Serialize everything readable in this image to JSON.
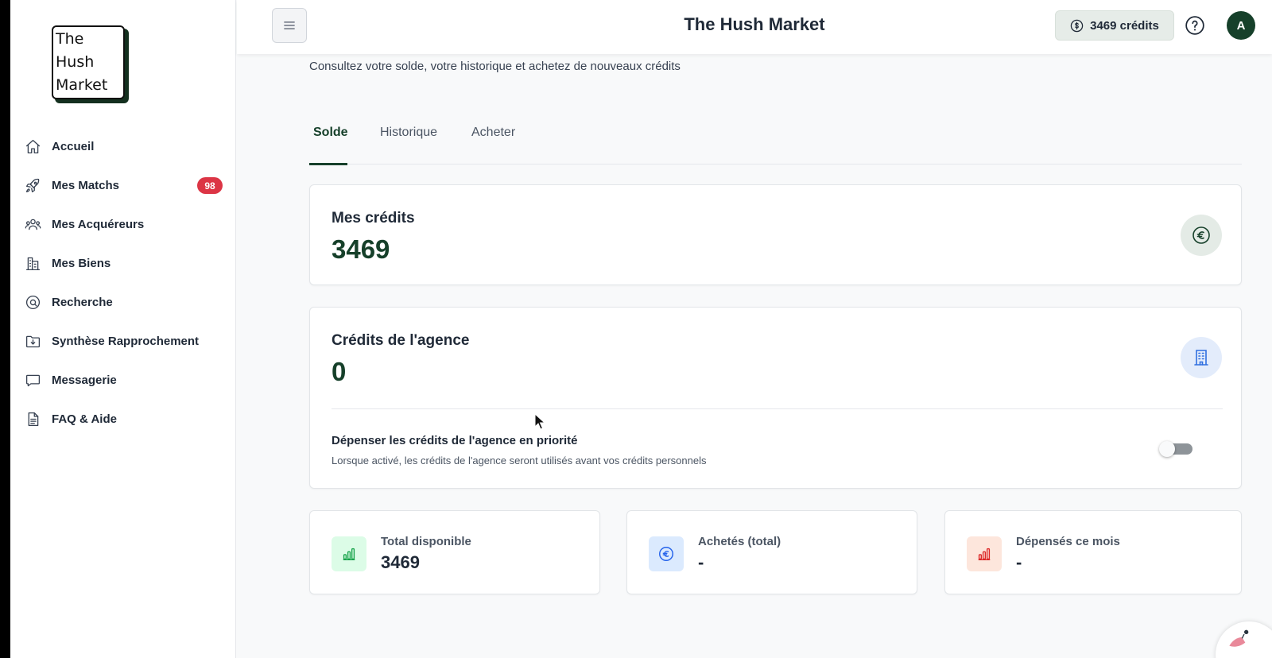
{
  "app": {
    "title": "The Hush Market"
  },
  "logo": {
    "lines": [
      "The",
      "Hush",
      "Market"
    ]
  },
  "sidebar": {
    "items": [
      {
        "label": "Accueil",
        "icon": "home-icon"
      },
      {
        "label": "Mes Matchs",
        "icon": "rocket-icon",
        "badge": "98"
      },
      {
        "label": "Mes Acquéreurs",
        "icon": "users-icon"
      },
      {
        "label": "Mes Biens",
        "icon": "buildings-icon"
      },
      {
        "label": "Recherche",
        "icon": "at-search-icon"
      },
      {
        "label": "Synthèse Rapprochement",
        "icon": "folder-download-icon"
      },
      {
        "label": "Messagerie",
        "icon": "chat-bubble-icon"
      },
      {
        "label": "FAQ & Aide",
        "icon": "document-icon"
      }
    ]
  },
  "header": {
    "credits_label": "3469 crédits",
    "avatar_initial": "A",
    "menu_icon": "hamburger-icon",
    "help_icon": "help-circle-icon"
  },
  "main": {
    "subtitle": "Consultez votre solde, votre historique et achetez de nouveaux crédits",
    "tabs": [
      {
        "label": "Solde",
        "active": true
      },
      {
        "label": "Historique",
        "active": false
      },
      {
        "label": "Acheter",
        "active": false
      }
    ],
    "my_credits": {
      "title": "Mes crédits",
      "value": "3469",
      "icon": "euro-coin-icon"
    },
    "agency_credits": {
      "title": "Crédits de l'agence",
      "value": "0",
      "icon": "office-building-icon",
      "priority_title": "Dépenser les crédits de l'agence en priorité",
      "priority_description": "Lorsque activé, les crédits de l'agence seront utilisés avant vos crédits personnels",
      "priority_enabled": false
    },
    "stats": [
      {
        "label": "Total disponible",
        "value": "3469",
        "icon": "bar-chart-icon",
        "color": "#16a34a"
      },
      {
        "label": "Achetés (total)",
        "value": "-",
        "icon": "euro-icon",
        "color": "#2563eb"
      },
      {
        "label": "Dépensés ce mois",
        "value": "-",
        "icon": "bar-chart-icon",
        "color": "#dc2626"
      }
    ]
  },
  "colors": {
    "brand": "#16402a",
    "badge": "#dc3545",
    "credits_pill_bg": "#e6ece8"
  }
}
